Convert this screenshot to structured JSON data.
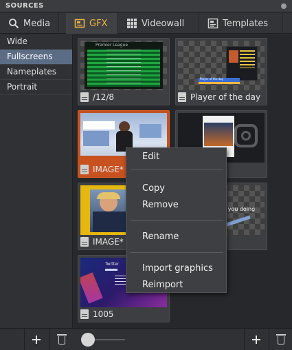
{
  "panel": {
    "title": "SOURCES"
  },
  "tabs": [
    {
      "label": "Media",
      "icon": "search-icon"
    },
    {
      "label": "GFX",
      "icon": "folder-icon",
      "active": true
    },
    {
      "label": "Videowall",
      "icon": "grid-icon"
    },
    {
      "label": "Templates",
      "icon": "template-icon"
    }
  ],
  "sidebar": {
    "items": [
      {
        "label": "Wide"
      },
      {
        "label": "Fullscreens",
        "selected": true
      },
      {
        "label": "Nameplates"
      },
      {
        "label": "Portrait"
      }
    ]
  },
  "thumbnails": [
    {
      "label": "/12/8",
      "preview_title": "Premier League"
    },
    {
      "label": "Player of the day",
      "preview_title": "Player of the day"
    },
    {
      "label": "IMAGE*",
      "selected": true
    },
    {
      "label": ""
    },
    {
      "label": "IMAGE*"
    },
    {
      "label": "",
      "preview_text": "re you doing"
    },
    {
      "label": "1005",
      "preview_title": "Twitter"
    }
  ],
  "context_menu": {
    "items": [
      "Edit",
      "Copy",
      "Remove",
      "Rename",
      "Import graphics",
      "Reimport"
    ]
  },
  "colors": {
    "accent": "#f1b640",
    "selected_thumb": "#c7511f",
    "selected_sidebar": "#5b6c85"
  }
}
